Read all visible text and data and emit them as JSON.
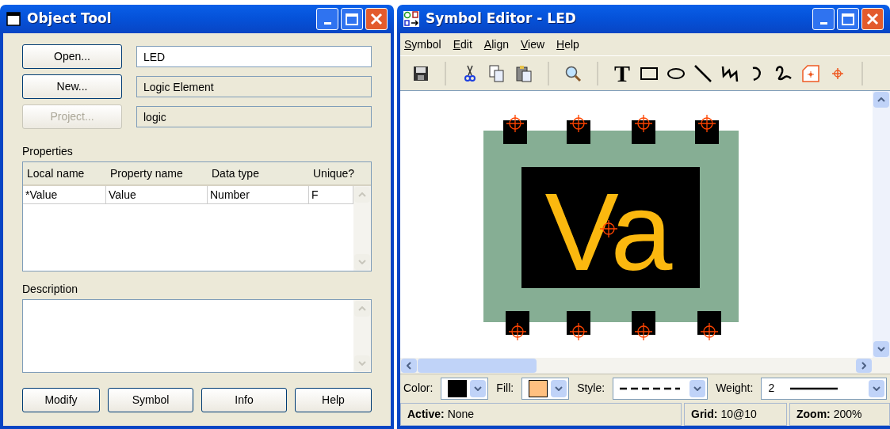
{
  "object_tool": {
    "title": "Object Tool",
    "rows": [
      {
        "button": "Open...",
        "disabled": false,
        "value": "LED",
        "editable": true
      },
      {
        "button": "New...",
        "disabled": false,
        "value": "Logic Element",
        "editable": false
      },
      {
        "button": "Project...",
        "disabled": true,
        "value": "logic",
        "editable": false
      }
    ],
    "properties": {
      "label": "Properties",
      "columns": [
        "Local name",
        "Property name",
        "Data type",
        "Unique?"
      ],
      "rows": [
        [
          "*Value",
          "Value",
          "Number",
          "F"
        ]
      ]
    },
    "description": {
      "label": "Description"
    },
    "buttons": [
      "Modify",
      "Symbol",
      "Info",
      "Help"
    ]
  },
  "symbol_editor": {
    "title": "Symbol Editor - LED",
    "menu": [
      "Symbol",
      "Edit",
      "Align",
      "View",
      "Help"
    ],
    "toolbar": [
      {
        "kind": "save"
      },
      {
        "kind": "sep"
      },
      {
        "kind": "cut"
      },
      {
        "kind": "copy"
      },
      {
        "kind": "paste"
      },
      {
        "kind": "sep"
      },
      {
        "kind": "zoom"
      },
      {
        "kind": "sep"
      },
      {
        "kind": "text",
        "label": "T"
      },
      {
        "kind": "rect"
      },
      {
        "kind": "ellipse"
      },
      {
        "kind": "line"
      },
      {
        "kind": "polyline"
      },
      {
        "kind": "arc"
      },
      {
        "kind": "curve"
      },
      {
        "kind": "pin"
      },
      {
        "kind": "origin"
      },
      {
        "kind": "sep"
      }
    ],
    "symbol": {
      "text": "Va"
    },
    "pickers": [
      {
        "label": "Color:",
        "color": "#000000"
      },
      {
        "label": "Fill:",
        "color": "#ffc080"
      }
    ],
    "style": {
      "label": "Style:"
    },
    "weight": {
      "label": "Weight:",
      "value": "2"
    },
    "status": [
      {
        "label": "Active:",
        "value": "None"
      },
      {
        "label": "Grid:",
        "value": "10@10"
      },
      {
        "label": "Zoom:",
        "value": "200%"
      }
    ]
  }
}
